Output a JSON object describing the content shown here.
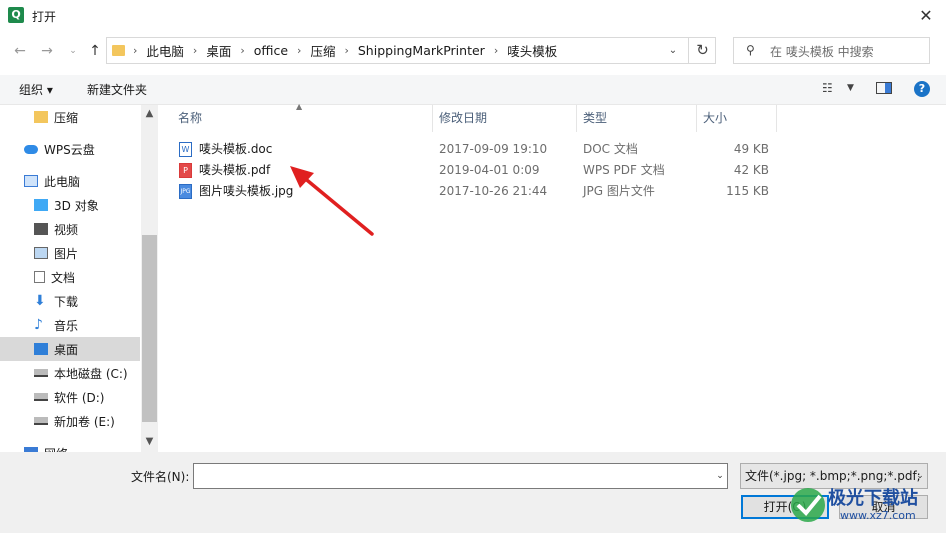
{
  "window": {
    "title": "打开",
    "app_icon_letter": "Q"
  },
  "address": {
    "crumbs": [
      "此电脑",
      "桌面",
      "office",
      "压缩",
      "ShippingMarkPrinter",
      "唛头模板"
    ]
  },
  "search": {
    "placeholder": "在 唛头模板 中搜索"
  },
  "toolbar": {
    "organize": "组织 ▾",
    "new_folder": "新建文件夹"
  },
  "nav": {
    "items": [
      "压缩",
      "WPS云盘",
      "此电脑",
      "3D 对象",
      "视频",
      "图片",
      "文档",
      "下载",
      "音乐",
      "桌面",
      "本地磁盘 (C:)",
      "软件 (D:)",
      "新加卷 (E:)",
      "网络"
    ],
    "selected": "桌面"
  },
  "columns": {
    "name": "名称",
    "date": "修改日期",
    "type": "类型",
    "size": "大小"
  },
  "files": [
    {
      "name": "唛头模板.doc",
      "date": "2017-09-09 19:10",
      "type": "DOC 文档",
      "size": "49 KB",
      "icon": "doc-file-icon"
    },
    {
      "name": "唛头模板.pdf",
      "date": "2019-04-01 0:09",
      "type": "WPS PDF 文档",
      "size": "42 KB",
      "icon": "pdf-file-icon"
    },
    {
      "name": "图片唛头模板.jpg",
      "date": "2017-10-26 21:44",
      "type": "JPG 图片文件",
      "size": "115 KB",
      "icon": "jpg-file-icon"
    }
  ],
  "footer": {
    "filename_label": "文件名(N):",
    "filename_value": "",
    "filter": "文件(*.jpg; *.bmp;*.png;*.pdf;",
    "open": "打开(O)",
    "cancel": "取消"
  },
  "watermark": {
    "text": "极光下载站",
    "url_text": "www.xz7.com"
  },
  "colors": {
    "accent": "#0078d7",
    "arrow": "#e02020"
  }
}
